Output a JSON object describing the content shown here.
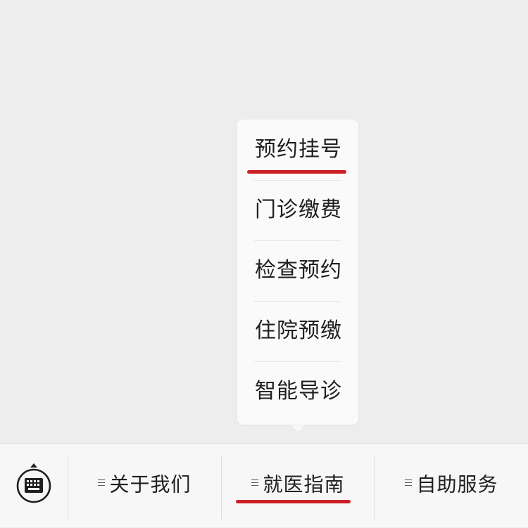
{
  "submenu": {
    "items": [
      {
        "label": "预约挂号",
        "active": true
      },
      {
        "label": "门诊缴费",
        "active": false
      },
      {
        "label": "检查预约",
        "active": false
      },
      {
        "label": "住院预缴",
        "active": false
      },
      {
        "label": "智能导诊",
        "active": false
      }
    ]
  },
  "menubar": {
    "keyboard_icon": "keyboard-icon",
    "items": [
      {
        "label": "关于我们",
        "icon": "menu-lines-icon",
        "active": false
      },
      {
        "label": "就医指南",
        "icon": "menu-lines-icon",
        "active": true
      },
      {
        "label": "自助服务",
        "icon": "menu-lines-icon",
        "active": false
      }
    ]
  },
  "colors": {
    "accent": "#cc1f24",
    "background": "#ededed",
    "bar": "#f7f7f7",
    "text": "#1f1f1f"
  }
}
